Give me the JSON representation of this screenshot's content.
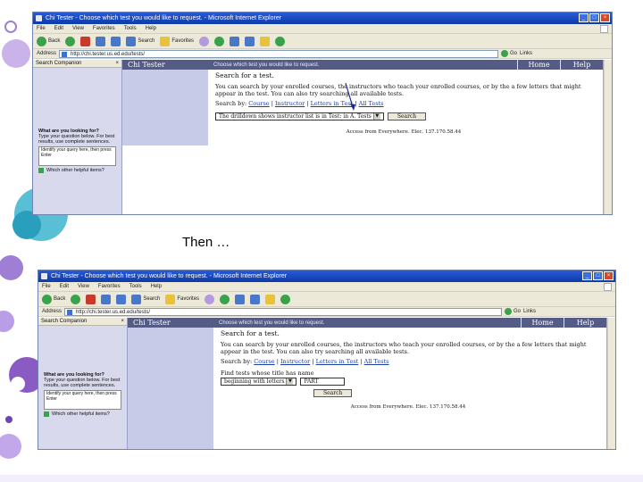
{
  "slide": {
    "caption": "Then …",
    "colors": {
      "accent_purple": "#8a5bc2",
      "accent_teal": "#58bfd5",
      "header_bar": "#545b85",
      "left_column": "#c7cbe8"
    }
  },
  "browser_top": {
    "title": "Chi Tester - Choose which test you would like to request. - Microsoft Internet Explorer",
    "menu": [
      "File",
      "Edit",
      "View",
      "Favorites",
      "Tools",
      "Help"
    ],
    "toolbar": {
      "back": "Back",
      "search": "Search",
      "favorites": "Favorites"
    },
    "address_label": "Address",
    "address": "http://chi.tester.us.ed.edu/tests/",
    "go": "Go",
    "links": "Links",
    "side_pane": {
      "title": "Search Companion",
      "question": "What are you looking for?",
      "tip": "Type your question below. For best results, use complete sentences.",
      "box_text": "Identify your query here, then press Enter",
      "link": "Which other helpful items?"
    },
    "page": {
      "site_title": "Chi Tester",
      "subtitle": "Choose which test you would like to request.",
      "home": "Home",
      "help": "Help",
      "heading": "Search for a test.",
      "intro": "You can search by your enrolled courses, the instructors who teach your enrolled courses, or by the a few letters that might appear in the test. You can also try searching all available tests.",
      "search_by_label": "Search by:",
      "search_links": [
        "Course",
        "Instructor",
        "Letters in Test",
        "All Tests"
      ],
      "select_value": "The drilldown shows instructor list is in Test: in A. Tests",
      "search_button": "Search",
      "access": "Access from Everywhere. Elec. 137.170.58.44"
    }
  },
  "browser_bottom": {
    "title": "Chi Tester - Choose which test you would like to request. - Microsoft Internet Explorer",
    "menu": [
      "File",
      "Edit",
      "View",
      "Favorites",
      "Tools",
      "Help"
    ],
    "toolbar": {
      "back": "Back",
      "search": "Search",
      "favorites": "Favorites"
    },
    "address_label": "Address",
    "address": "http://chi.tester.us.ed.edu/tests/",
    "go": "Go",
    "links": "Links",
    "side_pane": {
      "title": "Search Companion",
      "question": "What are you looking for?",
      "tip": "Type your question below. For best results, use complete sentences.",
      "box_text": "Identify your query here, then press Enter",
      "link": "Which other helpful items?"
    },
    "page": {
      "site_title": "Chi Tester",
      "subtitle": "Choose which test you would like to request.",
      "home": "Home",
      "help": "Help",
      "heading": "Search for a test.",
      "intro": "You can search by your enrolled courses, the instructors who teach your enrolled courses, or by the a few letters that might appear in the test. You can also try searching all available tests.",
      "search_by_label": "Search by:",
      "search_links": [
        "Course",
        "Instructor",
        "Letters in Test",
        "All Tests"
      ],
      "find_label": "Find tests whose title has name",
      "select_value": "beginning with letters",
      "input_value": "PART",
      "search_button": "Search",
      "access": "Access from Everywhere. Elec. 137.170.58.44"
    }
  }
}
